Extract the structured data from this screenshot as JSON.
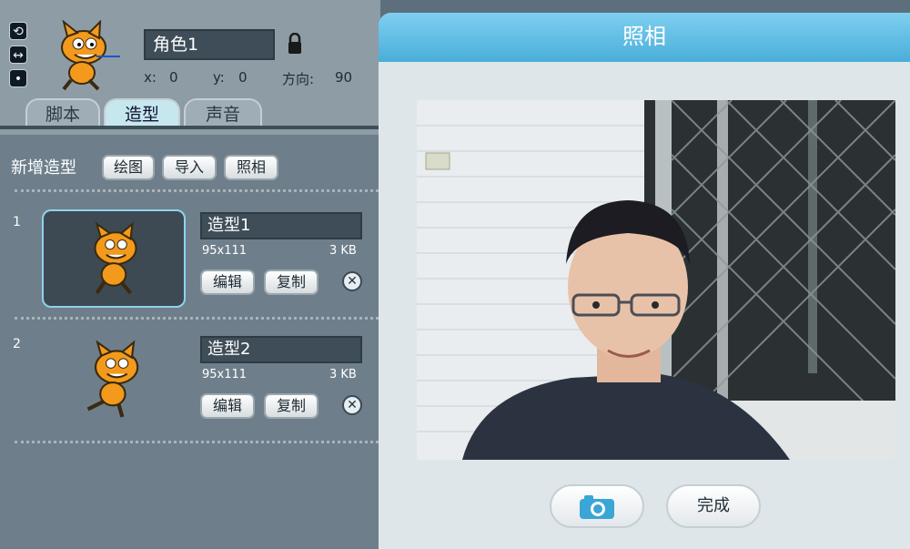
{
  "sprite": {
    "name": "角色1",
    "x_label": "x:",
    "x_value": "0",
    "y_label": "y:",
    "y_value": "0",
    "direction_label": "方向:",
    "direction_value": "90"
  },
  "tabs": [
    {
      "label": "脚本",
      "active": false
    },
    {
      "label": "造型",
      "active": true
    },
    {
      "label": "声音",
      "active": false
    }
  ],
  "new_costume": {
    "label": "新增造型",
    "paint": "绘图",
    "import": "导入",
    "camera": "照相"
  },
  "costumes": [
    {
      "index": "1",
      "name": "造型1",
      "size": "95x111",
      "kb": "3 KB",
      "edit": "编辑",
      "copy": "复制"
    },
    {
      "index": "2",
      "name": "造型2",
      "size": "95x111",
      "kb": "3 KB",
      "edit": "编辑",
      "copy": "复制"
    }
  ],
  "camera_dialog": {
    "title": "照相",
    "done": "完成"
  },
  "colors": {
    "accent": "#4aaed9",
    "selected_border": "#8fd2ec",
    "cat_orange": "#f39a1c"
  },
  "icons": {
    "rotate": "rotate-icon",
    "flip": "flip-icon",
    "no_rotate": "no-rotate-icon",
    "lock": "lock-icon",
    "camera": "camera-icon",
    "delete": "close-icon"
  }
}
